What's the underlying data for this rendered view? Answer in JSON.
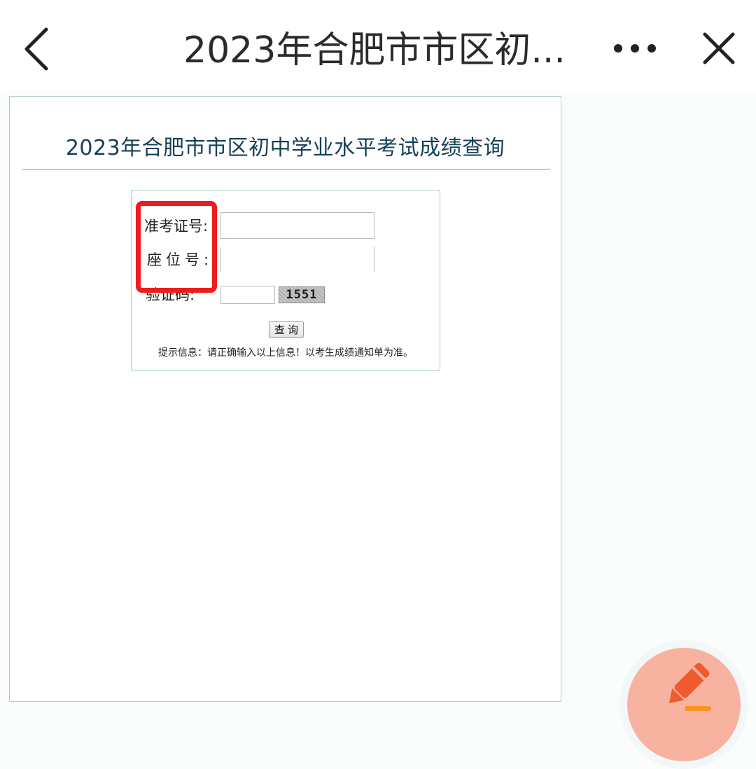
{
  "topbar": {
    "title": "2023年合肥市市区初...",
    "back_icon": "chevron-left-icon",
    "more_icon": "more-horizontal-icon",
    "close_icon": "close-icon"
  },
  "web": {
    "site_title": "2023年合肥市市区初中学业水平考试成绩查询",
    "form": {
      "ticket_label": "准考证号:",
      "ticket_value": "",
      "seat_label": "座位号:",
      "seat_value": "",
      "captcha_label": "验证码:",
      "captcha_value": "",
      "captcha_code": "1551",
      "submit_label": "查询",
      "hint": "提示信息：请正确输入以上信息！以考生成绩通知单为准。"
    }
  },
  "fab": {
    "icon": "pencil-edit-icon"
  },
  "colors": {
    "title_text": "#17405a",
    "frame_border": "#a9cccc",
    "highlight": "#ee1c1c",
    "fab_background": "#f7b2a0",
    "fab_icon": "#f05a2c"
  }
}
